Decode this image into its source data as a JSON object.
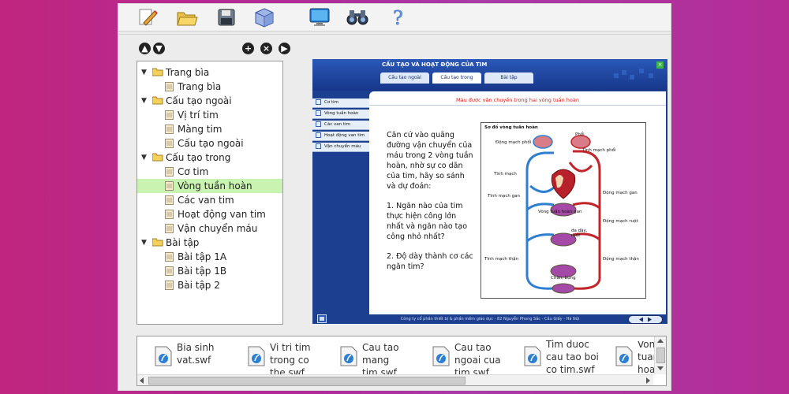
{
  "toolbar": {
    "icons": [
      "edit-icon",
      "open-folder-icon",
      "save-disk-icon",
      "cube-icon",
      "monitor-icon",
      "binoculars-icon",
      "help-icon"
    ]
  },
  "tree_controls": {
    "up": "▲",
    "down": "▼",
    "add": "+",
    "remove": "×",
    "next": "▶"
  },
  "tree": {
    "groups": [
      {
        "label": "Trang bìa",
        "items": [
          "Trang bìa"
        ]
      },
      {
        "label": "Cấu tạo ngoài",
        "items": [
          "Vị trí tim",
          "Màng tim",
          "Cấu tạo ngoài"
        ]
      },
      {
        "label": "Cấu tạo trong",
        "items": [
          "Cơ tim",
          "Vòng tuần hoàn",
          "Các van tim",
          "Hoạt động van tim",
          "Vận chuyển máu"
        ]
      },
      {
        "label": "Bài tập",
        "items": [
          "Bài tập 1A",
          "Bài tập 1B",
          "Bài tập 2"
        ]
      }
    ],
    "selected": "Vòng tuần hoàn"
  },
  "flash": {
    "title": "CẤU TẠO VÀ HOẠT ĐỘNG CỦA TIM",
    "tabs": [
      "Cấu tạo ngoài",
      "Cấu tạo trong",
      "Bài tập"
    ],
    "active_tab": "Cấu tạo trong",
    "nav": [
      "Cơ tim",
      "Vòng tuần hoàn",
      "Các van tim",
      "Hoạt động van tim",
      "Vận chuyển máu"
    ],
    "subtitle": "Máu được vận chuyển trong hai vòng tuần hoàn",
    "question_intro": "Căn cứ vào quãng đường vận chuyển của máu trong 2 vòng tuần hoàn, nhờ sự co dãn của tim, hãy so sánh và dự đoán:",
    "question_1": "1. Ngăn nào của tim thực hiện công lớn nhất và ngăn nào tạo công nhỏ nhất?",
    "question_2": "2. Độ dày thành cơ các ngăn tim?",
    "diagram_title": "Sơ đồ vòng tuần hoàn",
    "diagram_labels": {
      "phoi": "Phổi",
      "dong_mach_phoi": "Động mạch phổi",
      "tinh_mach_phoi": "Tĩnh mạch phổi",
      "tinh_mach": "Tĩnh mạch",
      "tinh_mach_gan": "Tĩnh mạch gan",
      "dong_mach_gan": "Động mạch gan",
      "vong_tuan_hoan_gan": "Vòng tuần hoàn gan",
      "dong_mach_ruot": "Động mạch ruột",
      "da_day_ruot": "dạ dày, ruột",
      "tinh_mach_than": "Tĩnh mạch thận",
      "dong_mach_than": "Động mạch thận",
      "chan_bung": "Chân, bụng"
    },
    "footer": "Công ty cổ phần thiết bị & phần mềm giáo dục - 82 Nguyễn Phong Sắc - Cầu Giấy - Hà Nội",
    "close": "×"
  },
  "files": [
    {
      "name": "Bia sinh vat.swf"
    },
    {
      "name": "Vi tri tim trong co the.swf"
    },
    {
      "name": "Cau tao mang tim.swf"
    },
    {
      "name": "Cau tao ngoai cua tim.swf"
    },
    {
      "name": "Tim duoc cau tao boi co tim.swf"
    },
    {
      "name": "Vong tuan hoan dong"
    }
  ],
  "colors": {
    "background": "#b02a9a",
    "selection": "#c8f3b0",
    "flash_blue": "#1d3f8f",
    "subtitle_red": "#d01e1e",
    "artery_red": "#c0262b",
    "vein_blue": "#2f7fd0"
  }
}
